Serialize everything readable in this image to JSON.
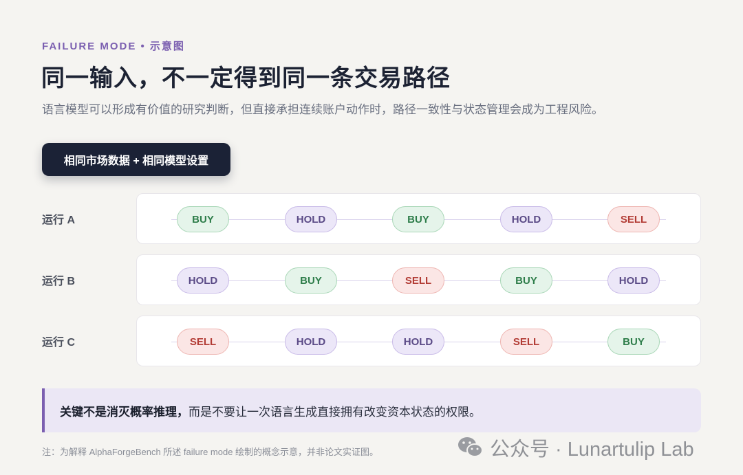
{
  "header": {
    "eyebrow": "FAILURE MODE • 示意图",
    "title": "同一输入，不一定得到同一条交易路径",
    "subtitle": "语言模型可以形成有价值的研究判断，但直接承担连续账户动作时，路径一致性与状态管理会成为工程风险。"
  },
  "input_chip": {
    "label": "相同市场数据 + 相同模型设置"
  },
  "runs": [
    {
      "label": "运行 A",
      "actions": [
        "BUY",
        "HOLD",
        "BUY",
        "HOLD",
        "SELL"
      ]
    },
    {
      "label": "运行 B",
      "actions": [
        "HOLD",
        "BUY",
        "SELL",
        "BUY",
        "HOLD"
      ]
    },
    {
      "label": "运行 C",
      "actions": [
        "SELL",
        "HOLD",
        "HOLD",
        "SELL",
        "BUY"
      ]
    }
  ],
  "callout": {
    "bold": "关键不是消灭概率推理，",
    "rest": "而是不要让一次语言生成直接拥有改变资本状态的权限。"
  },
  "footnote": "注：为解释 AlphaForgeBench 所述 failure mode 绘制的概念示意，并非论文实证图。",
  "watermark": {
    "text": "公众号 · Lunartulip Lab",
    "icon": "wechat-icon"
  },
  "colors": {
    "accent": "#7b5fb0",
    "dark_chip": "#1b2236",
    "buy": "#2e7d4a",
    "hold": "#5a4a86",
    "sell": "#b23c35"
  }
}
